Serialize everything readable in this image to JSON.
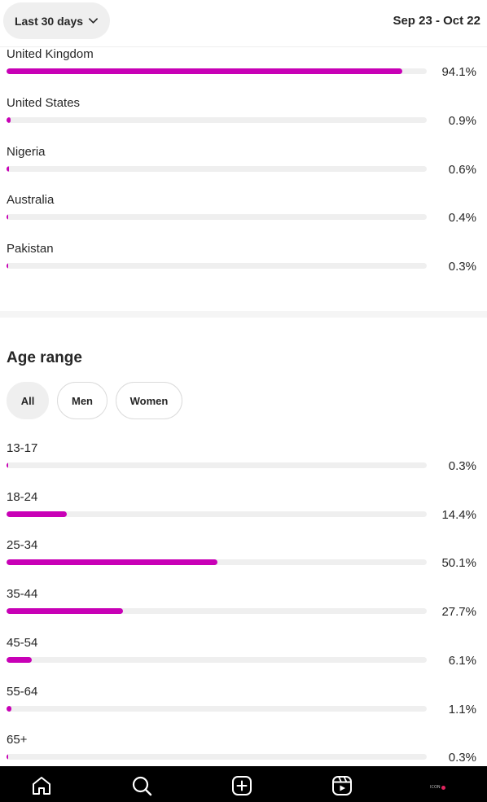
{
  "header": {
    "range_label": "Last 30 days",
    "date_range": "Sep 23 - Oct 22"
  },
  "countries": [
    {
      "label": "United Kingdom",
      "percent": "94.1%",
      "value": 94.1
    },
    {
      "label": "United States",
      "percent": "0.9%",
      "value": 0.9
    },
    {
      "label": "Nigeria",
      "percent": "0.6%",
      "value": 0.6
    },
    {
      "label": "Australia",
      "percent": "0.4%",
      "value": 0.4
    },
    {
      "label": "Pakistan",
      "percent": "0.3%",
      "value": 0.3
    }
  ],
  "age_section": {
    "title": "Age range",
    "filters": [
      "All",
      "Men",
      "Women"
    ],
    "active_filter": "All",
    "rows": [
      {
        "label": "13-17",
        "percent": "0.3%",
        "value": 0.3
      },
      {
        "label": "18-24",
        "percent": "14.4%",
        "value": 14.4
      },
      {
        "label": "25-34",
        "percent": "50.1%",
        "value": 50.1
      },
      {
        "label": "35-44",
        "percent": "27.7%",
        "value": 27.7
      },
      {
        "label": "45-54",
        "percent": "6.1%",
        "value": 6.1
      },
      {
        "label": "55-64",
        "percent": "1.1%",
        "value": 1.1
      },
      {
        "label": "65+",
        "percent": "0.3%",
        "value": 0.3
      }
    ]
  },
  "tabbar": {
    "tabs": [
      "home-icon",
      "search-icon",
      "create-icon",
      "reels-icon",
      "profile-icon"
    ],
    "profile_text": "ICON"
  },
  "colors": {
    "bar_fill": "#c800b6",
    "track": "#efefef",
    "tabbar_bg": "#000000"
  }
}
